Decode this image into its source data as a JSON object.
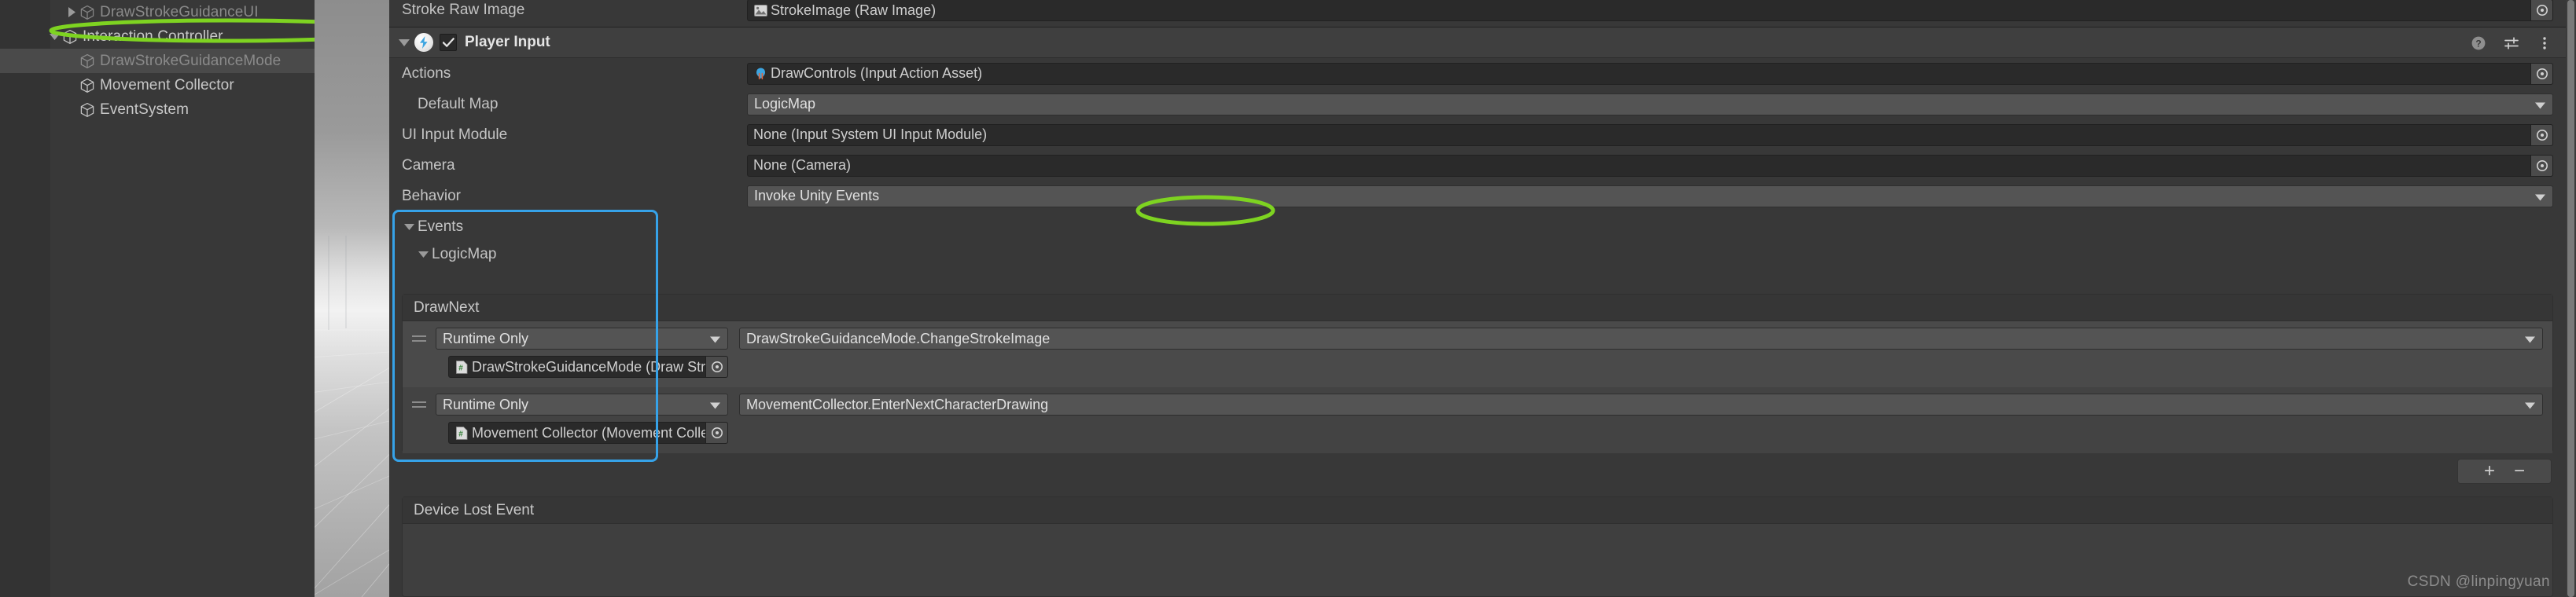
{
  "hierarchy": {
    "items": [
      {
        "label": "DrawStrokeGuidanceUI",
        "indent": 2,
        "foldout": "collapsed",
        "state": "dim",
        "selected": false
      },
      {
        "label": "Interaction Controller",
        "indent": 1,
        "foldout": "expanded",
        "state": "normal",
        "selected": false
      },
      {
        "label": "DrawStrokeGuidanceMode",
        "indent": 2,
        "foldout": "none",
        "state": "dim",
        "selected": true
      },
      {
        "label": "Movement Collector",
        "indent": 2,
        "foldout": "none",
        "state": "normal",
        "selected": false
      },
      {
        "label": "EventSystem",
        "indent": 2,
        "foldout": "none",
        "state": "normal",
        "selected": false
      }
    ]
  },
  "inspector": {
    "top_row": {
      "label": "Stroke Raw Image",
      "value": "StrokeImage (Raw Image)",
      "icon": "raw-image-icon"
    },
    "component": {
      "title": "Player Input",
      "enabled": true,
      "foldout": "expanded",
      "icon": "player-input-bolt-icon",
      "tools": [
        "help-icon",
        "preset-icon",
        "kebab-menu-icon"
      ]
    },
    "fields": [
      {
        "name": "actions",
        "label": "Actions",
        "indent": 0,
        "type": "object",
        "value": "DrawControls (Input Action Asset)",
        "icon": "input-action-asset-icon"
      },
      {
        "name": "default-map",
        "label": "Default Map",
        "indent": 1,
        "type": "popup",
        "value": "LogicMap"
      },
      {
        "name": "ui-input-module",
        "label": "UI Input Module",
        "indent": 0,
        "type": "object",
        "value": "None (Input System UI Input Module)",
        "icon": ""
      },
      {
        "name": "camera",
        "label": "Camera",
        "indent": 0,
        "type": "object",
        "value": "None (Camera)",
        "icon": ""
      },
      {
        "name": "behavior",
        "label": "Behavior",
        "indent": 0,
        "type": "popup",
        "value": "Invoke Unity Events"
      }
    ],
    "events": {
      "label": "Events",
      "foldout": "expanded",
      "map": {
        "label": "LogicMap",
        "foldout": "expanded"
      },
      "action_event": {
        "title": "DrawNext",
        "entries": [
          {
            "listener_mode": "Runtime Only",
            "target": "DrawStrokeGuidanceMode (Draw Stroke Guidance",
            "target_icon": "cs-script-icon",
            "function": "DrawStrokeGuidanceMode.ChangeStrokeImage"
          },
          {
            "listener_mode": "Runtime Only",
            "target": "Movement Collector (Movement Collector)",
            "target_icon": "cs-script-icon",
            "function": "MovementCollector.EnterNextCharacterDrawing"
          }
        ],
        "add_label": "+",
        "remove_label": "−"
      }
    },
    "device_lost_event": {
      "label": "Device Lost Event"
    }
  },
  "watermark": "CSDN @linpingyuan",
  "annotations": {
    "hierarchy_highlight_color": "#7ed321",
    "behavior_highlight_color": "#7ed321",
    "events_box_color": "#36a2e8"
  }
}
